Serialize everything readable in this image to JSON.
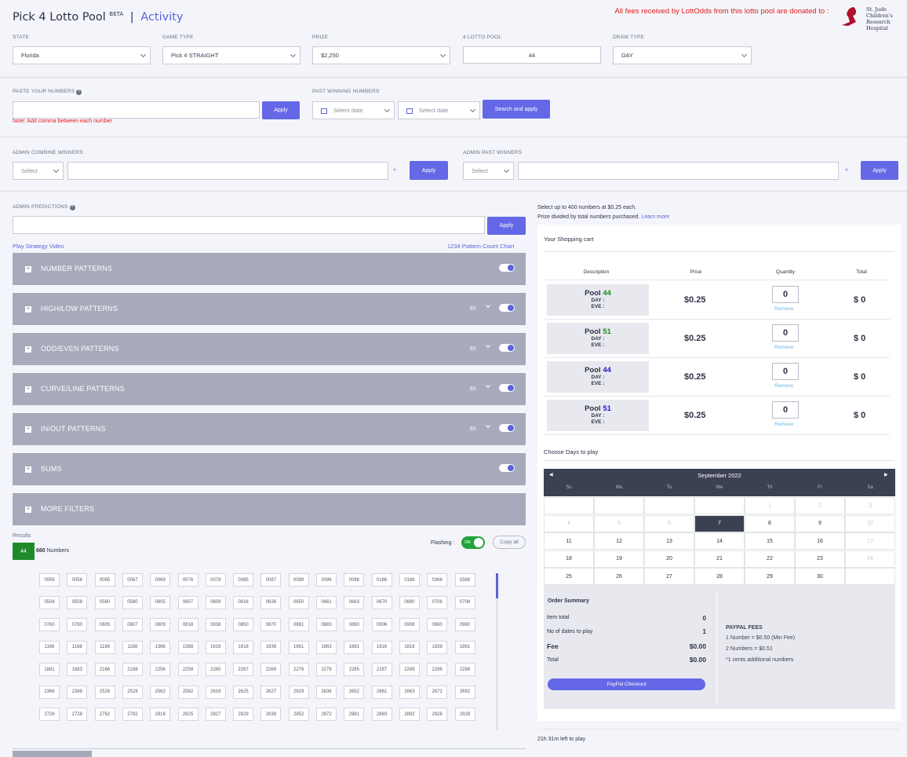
{
  "header": {
    "title": "Pick 4 Lotto Pool",
    "beta": "BETA",
    "sep": "|",
    "activity": "Activity",
    "donation": "All fees received by LottOdds from this lotto pool are donated to :",
    "logo_text": "St. Jude Children's Research Hospital"
  },
  "filters": {
    "state_label": "STATE",
    "state": "Florida",
    "game_label": "GAME TYPE",
    "game": "Pick 4 STRAIGHT",
    "prize_label": "PRIZE",
    "prize": "$2,250",
    "pool_label": "4 LOTTO POOL",
    "pool": "44",
    "draw_label": "DRAW TYPE",
    "draw": "DAY"
  },
  "paste": {
    "label": "PASTE YOUR NUMBERS",
    "apply": "Apply",
    "note": "Note: Add comma between each number",
    "past_label": "PAST WINNING NUMBERS",
    "date1": "Select date",
    "date2": "Select date",
    "search": "Search and apply"
  },
  "admin": {
    "combine_label": "ADMIN COMBINE WINNERS",
    "past_label": "ADMIN PAST WINNERS",
    "select": "Select",
    "apply": "Apply",
    "pred_label": "ADMIN PREDICTIONS"
  },
  "links": {
    "video": "Play Strategy Video",
    "chart": "1234 Pattern Count Chart"
  },
  "patterns": [
    {
      "title": "NUMBER PATTERNS",
      "count": ""
    },
    {
      "title": "HIGH/LOW PATTERNS",
      "count": "30"
    },
    {
      "title": "ODD/EVEN PATTERNS",
      "count": "30"
    },
    {
      "title": "CURVE/LINE PATTERNS",
      "count": "30"
    },
    {
      "title": "IN/OUT PATTERNS",
      "count": "30"
    },
    {
      "title": "SUMS",
      "count": ""
    },
    {
      "title": "MORE FILTERS",
      "count": ""
    }
  ],
  "results": {
    "label": "Results",
    "pool": "44",
    "count": "660",
    "count_label": "Numbers",
    "flashing": "Flashing :",
    "on": "ON",
    "copy": "Copy all"
  },
  "numbers": [
    "0056",
    "0058",
    "0065",
    "0067",
    "0069",
    "0076",
    "0078",
    "0085",
    "0087",
    "0089",
    "0096",
    "0098",
    "0166",
    "0188",
    "0366",
    "0388",
    "0506",
    "0508",
    "0560",
    "0580",
    "0605",
    "0607",
    "0609",
    "0616",
    "0636",
    "0650",
    "0661",
    "0663",
    "0670",
    "0690",
    "0706",
    "0708",
    "0760",
    "0780",
    "0805",
    "0807",
    "0809",
    "0818",
    "0838",
    "0850",
    "0870",
    "0881",
    "0883",
    "0890",
    "0906",
    "0908",
    "0960",
    "0980",
    "1166",
    "1168",
    "1186",
    "1188",
    "1366",
    "1388",
    "1616",
    "1618",
    "1636",
    "1661",
    "1663",
    "1681",
    "1816",
    "1818",
    "1838",
    "1861",
    "1881",
    "1883",
    "2166",
    "2188",
    "2256",
    "2258",
    "2265",
    "2267",
    "2269",
    "2276",
    "2278",
    "2285",
    "2287",
    "2289",
    "2296",
    "2298",
    "2366",
    "2388",
    "2526",
    "2528",
    "2562",
    "2582",
    "2616",
    "2625",
    "2627",
    "2629",
    "2636",
    "2652",
    "2661",
    "2663",
    "2672",
    "2692",
    "2726",
    "2728",
    "2762",
    "2782",
    "2818",
    "2825",
    "2827",
    "2829",
    "2838",
    "2852",
    "2872",
    "2881",
    "2883",
    "2892",
    "2926",
    "2928"
  ],
  "cart": {
    "info1": "Select up to 400 numbers at $0.25 each.",
    "info2": "Prize divided by total numbers purchased.",
    "learn": "Learn more",
    "title": "Your Shopping cart",
    "cols": [
      "Description",
      "Price",
      "Quantity",
      "Total"
    ],
    "rows": [
      {
        "pool": "Pool",
        "num": "44",
        "color": "#1d8a1d",
        "day": "DAY :",
        "eve": "EVE :",
        "price": "$0.25",
        "qty": "0",
        "remove": "Remove",
        "total": "$ 0"
      },
      {
        "pool": "Pool",
        "num": "51",
        "color": "#1d8a1d",
        "day": "DAY :",
        "eve": "EVE :",
        "price": "$0.25",
        "qty": "0",
        "remove": "Remove",
        "total": "$ 0"
      },
      {
        "pool": "Pool",
        "num": "44",
        "color": "#1a1ad6",
        "day": "DAY :",
        "eve": "EVE :",
        "price": "$0.25",
        "qty": "0",
        "remove": "Remove",
        "total": "$ 0"
      },
      {
        "pool": "Pool",
        "num": "51",
        "color": "#1a1ad6",
        "day": "DAY :",
        "eve": "EVE :",
        "price": "$0.25",
        "qty": "0",
        "remove": "Remove",
        "total": "$ 0"
      }
    ]
  },
  "calendar": {
    "title": "Choose Days to play",
    "month": "September 2022",
    "dow": [
      "Su",
      "Mo",
      "Tu",
      "We",
      "Th",
      "Fr",
      "Sa"
    ],
    "days": [
      [
        "",
        "",
        "",
        "",
        "1",
        "2",
        "3"
      ],
      [
        "4",
        "5",
        "6",
        "7",
        "8",
        "9",
        "10"
      ],
      [
        "11",
        "12",
        "13",
        "14",
        "15",
        "16",
        "17"
      ],
      [
        "18",
        "19",
        "20",
        "21",
        "22",
        "23",
        "24"
      ],
      [
        "25",
        "26",
        "27",
        "28",
        "29",
        "30",
        ""
      ]
    ]
  },
  "summary": {
    "title": "Order Summary",
    "item_label": "item total",
    "item": "0",
    "dates_label": "No of dates to play",
    "dates": "1",
    "fee_label": "Fee",
    "fee": "$0.00",
    "total_label": "Total",
    "total": "$0.00",
    "paypal": "PayPal Checkout",
    "fees_title": "PAYPAL FEES",
    "fee1": "1 Number = $0.50 (Min Fee)",
    "fee2": "2 Numbers = $0.51",
    "fee3": "*1 cents additional numbers"
  },
  "footer": {
    "left": "21h 31m left to play"
  }
}
